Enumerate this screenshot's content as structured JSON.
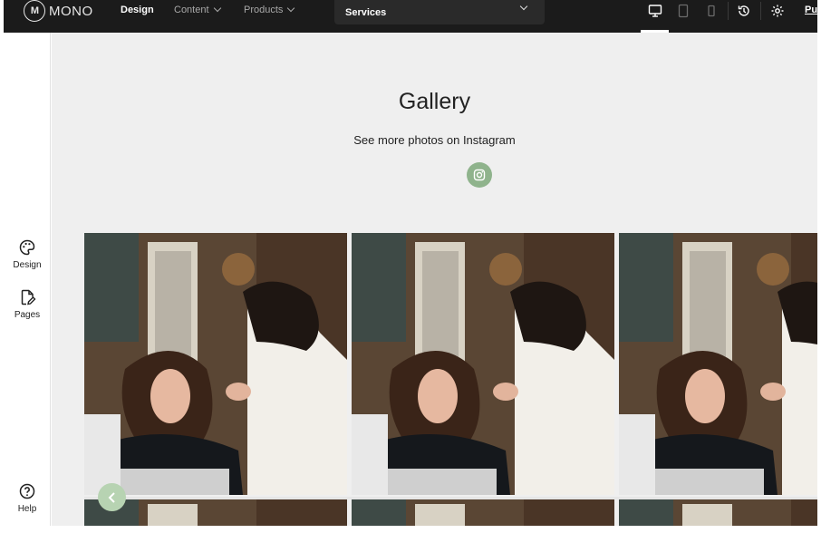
{
  "app": {
    "logo_mark": "M",
    "logo_text": "MONO",
    "nav": [
      {
        "label": "Design",
        "active": true
      },
      {
        "label": "Content",
        "active": false
      },
      {
        "label": "Products",
        "active": false
      }
    ],
    "page_select": "Services",
    "publish_label": "Pu"
  },
  "toolbar": {
    "icons": [
      "desktop-icon",
      "tablet-icon",
      "mobile-icon",
      "history-icon",
      "settings-icon"
    ],
    "active_view": "desktop"
  },
  "rail": {
    "design_label": "Design",
    "pages_label": "Pages",
    "help_label": "Help"
  },
  "gallery": {
    "title": "Gallery",
    "subtitle": "See more photos on Instagram"
  },
  "colors": {
    "topbar": "#1b1b1b",
    "accent_green": "#8fb38c",
    "canvas": "#efefef"
  }
}
